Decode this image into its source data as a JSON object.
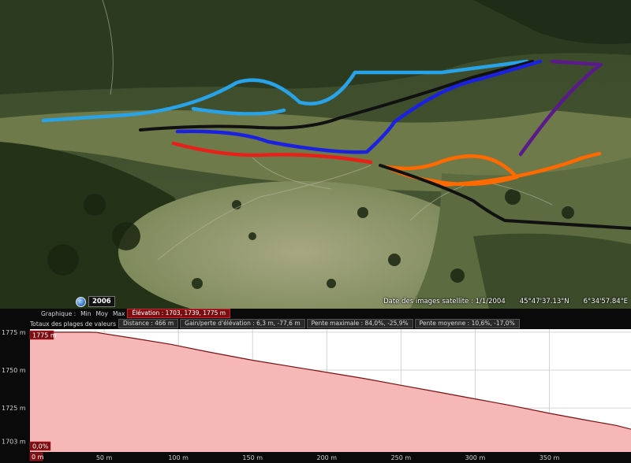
{
  "map": {
    "imagery_year": "2006",
    "satellite_date": "Date des images satellite : 1/1/2004",
    "latitude": "45°47'37.13\"N",
    "longitude": "6°34'57.84\"E",
    "routes": [
      {
        "name": "light-blue",
        "color": "#29a3e8"
      },
      {
        "name": "black-upper",
        "color": "#111111"
      },
      {
        "name": "dark-blue",
        "color": "#1a22e0"
      },
      {
        "name": "red",
        "color": "#e8201a"
      },
      {
        "name": "orange",
        "color": "#ff6a00"
      },
      {
        "name": "purple",
        "color": "#5a1a8a"
      },
      {
        "name": "black-lower",
        "color": "#111111"
      }
    ]
  },
  "profile": {
    "toolbar": {
      "graph_label": "Graphique :",
      "min": "Min",
      "avg": "Moy",
      "max": "Max",
      "elevation": "Élévation : 1703, 1739, 1775 m",
      "range_totals": "Totaux des plages de valeurs",
      "distance": "Distance : 466 m",
      "gain_loss": "Gain/perte d'élévation : 6,3 m, -77,6 m",
      "max_slope": "Pente maximale : 84,0%, -25,9%",
      "avg_slope": "Pente moyenne : 10,6%, -17,0%"
    },
    "readouts": {
      "top_value": "1775 m",
      "slope_value": "0,0%",
      "cursor_distance": "0 m"
    }
  },
  "chart_data": {
    "type": "area",
    "title": "",
    "xlabel": "",
    "ylabel": "",
    "x": [
      0,
      10,
      20,
      30,
      40,
      45,
      50,
      70,
      95,
      120,
      150,
      175,
      200,
      225,
      250,
      275,
      300,
      325,
      350,
      375,
      395,
      405
    ],
    "y": [
      1775,
      1775,
      1775,
      1775,
      1775,
      1774.8,
      1774,
      1771,
      1767,
      1762,
      1756.5,
      1752.5,
      1748.5,
      1744.5,
      1740,
      1735.5,
      1731,
      1726.5,
      1721.5,
      1717,
      1713.5,
      1711
    ],
    "xlim": [
      0,
      405
    ],
    "ylim": [
      1696,
      1777
    ],
    "xticks": [
      0,
      50,
      100,
      150,
      200,
      250,
      300,
      350
    ],
    "xtick_labels": [
      "0 m",
      "50 m",
      "100 m",
      "150 m",
      "200 m",
      "250 m",
      "300 m",
      "350 m"
    ],
    "yticks": [
      1775,
      1750,
      1725,
      1703
    ],
    "ytick_labels": [
      "1775 m",
      "1750 m",
      "1725 m",
      "1703 m"
    ],
    "grid": true,
    "line_color": "#7a0f12",
    "fill_color": "#f6b7b7"
  }
}
